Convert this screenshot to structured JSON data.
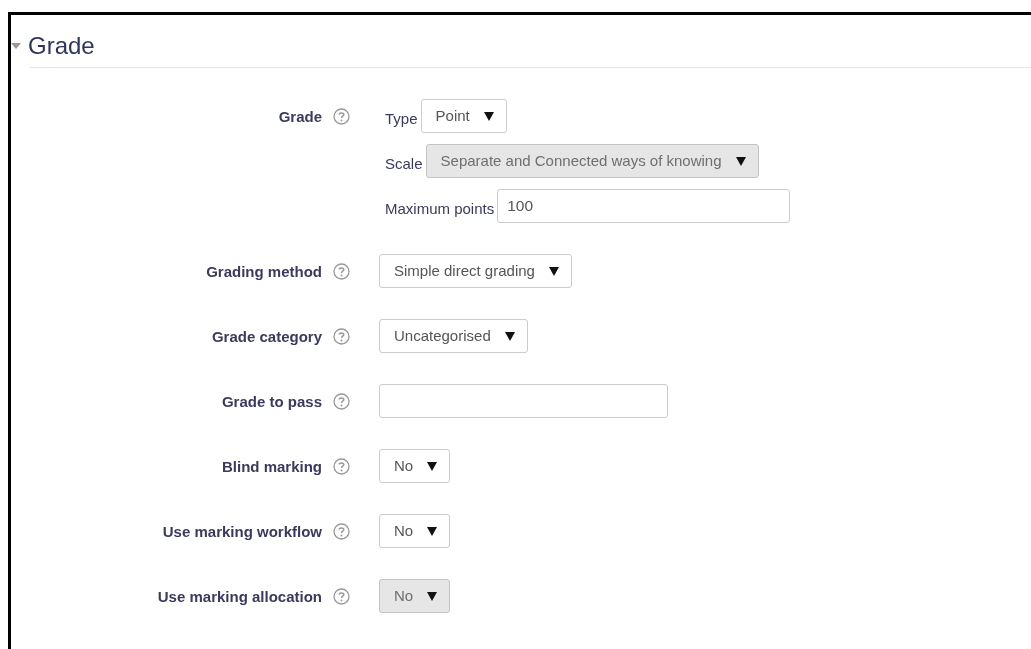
{
  "section": {
    "title": "Grade",
    "expanded": true
  },
  "fields": [
    {
      "label": "Grade",
      "kind": "group",
      "parts": [
        {
          "label": "Type",
          "kind": "select",
          "value": "Point",
          "disabled": false
        },
        {
          "label": "Scale",
          "kind": "select",
          "value": "Separate and Connected ways of knowing",
          "disabled": true
        },
        {
          "label": "Maximum points",
          "kind": "text",
          "value": "100"
        }
      ]
    },
    {
      "label": "Grading method",
      "kind": "select",
      "value": "Simple direct grading",
      "disabled": false
    },
    {
      "label": "Grade category",
      "kind": "select",
      "value": "Uncategorised",
      "disabled": false
    },
    {
      "label": "Grade to pass",
      "kind": "text"
    },
    {
      "label": "Blind marking",
      "kind": "select",
      "value": "No",
      "disabled": false
    },
    {
      "label": "Use marking workflow",
      "kind": "select",
      "value": "No",
      "disabled": false
    },
    {
      "label": "Use marking allocation",
      "kind": "select",
      "value": "No",
      "disabled": true
    }
  ]
}
